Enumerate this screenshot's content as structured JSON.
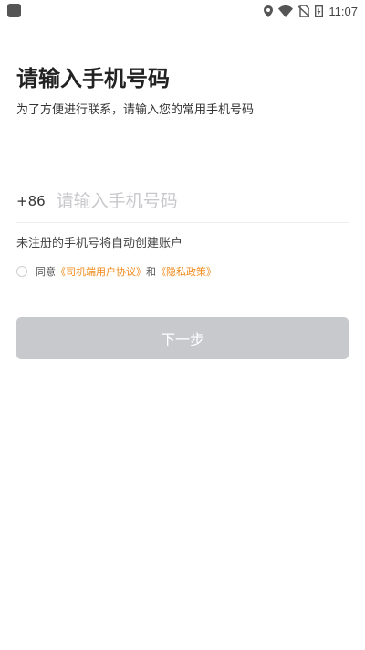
{
  "status_bar": {
    "time": "11:07",
    "icons": [
      "location-icon",
      "wifi-icon",
      "no-sim-icon",
      "battery-charging-icon"
    ]
  },
  "header": {
    "title": "请输入手机号码",
    "subtitle": "为了方便进行联系，请输入您的常用手机号码"
  },
  "phone": {
    "country_code": "+86",
    "placeholder": "请输入手机号码",
    "value": ""
  },
  "hint": "未注册的手机号将自动创建账户",
  "agreement": {
    "checked": false,
    "prefix": "同意",
    "user_agreement": "《司机端用户协议》",
    "conjunction": "和",
    "privacy_policy": "《隐私政策》",
    "link_color": "#f08a1a"
  },
  "next_button": {
    "label": "下一步",
    "enabled": false,
    "disabled_color": "#c8c9cd"
  }
}
